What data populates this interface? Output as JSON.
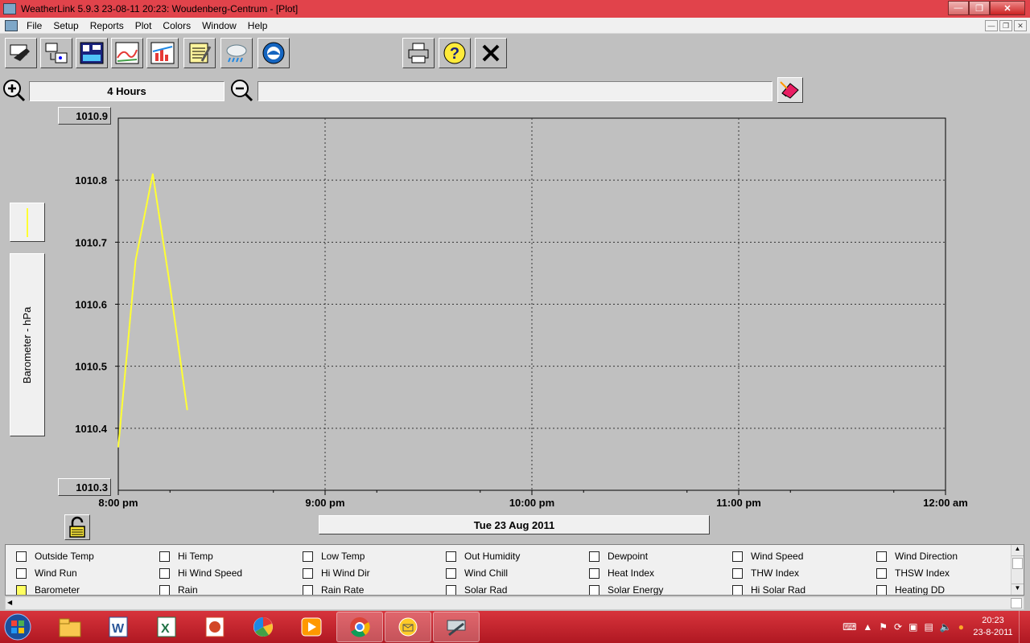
{
  "window": {
    "title": "WeatherLink 5.9.3  23-08-11  20:23: Woudenberg-Centrum - [Plot]"
  },
  "menu": [
    "File",
    "Setup",
    "Reports",
    "Plot",
    "Colors",
    "Window",
    "Help"
  ],
  "toolbar": {
    "icons": [
      "setup-icon",
      "download-icon",
      "bulletin-icon",
      "strip-chart-icon",
      "plot-icon",
      "notes-icon",
      "weather-icon",
      "noaa-icon",
      "print-icon",
      "help-icon",
      "close-icon"
    ]
  },
  "zoom": {
    "span_label": "4 Hours",
    "range_field": ""
  },
  "plot": {
    "y_axis_label": "Barometer - hPa",
    "y_top_label": "1010.9",
    "y_bottom_label": "1010.3",
    "date_label": "Tue 23 Aug 2011",
    "line_color": "#ffff33"
  },
  "chart_data": {
    "type": "line",
    "title": "",
    "ylabel": "Barometer - hPa",
    "xlabel": "Tue 23 Aug 2011",
    "ylim": [
      1010.3,
      1010.9
    ],
    "xlim": [
      "8:00 pm",
      "12:00 am"
    ],
    "yticks": [
      "1010.9",
      "1010.8",
      "1010.7",
      "1010.6",
      "1010.5",
      "1010.4",
      "1010.3"
    ],
    "xticks": [
      "8:00 pm",
      "9:00 pm",
      "10:00 pm",
      "11:00 pm",
      "12:00 am"
    ],
    "grid": true,
    "series": [
      {
        "x": [
          "20:00",
          "20:05",
          "20:10",
          "20:15",
          "20:20"
        ],
        "values": [
          1010.37,
          1010.67,
          1010.81,
          1010.63,
          1010.43
        ]
      }
    ]
  },
  "legend": [
    {
      "label": "Outside Temp",
      "checked": false
    },
    {
      "label": "Hi Temp",
      "checked": false
    },
    {
      "label": "Low Temp",
      "checked": false
    },
    {
      "label": "Out Humidity",
      "checked": false
    },
    {
      "label": "Dewpoint",
      "checked": false
    },
    {
      "label": "Wind Speed",
      "checked": false
    },
    {
      "label": "Wind Direction",
      "checked": false
    },
    {
      "label": "Wind Run",
      "checked": false
    },
    {
      "label": "Hi Wind Speed",
      "checked": false
    },
    {
      "label": "Hi Wind Dir",
      "checked": false
    },
    {
      "label": "Wind Chill",
      "checked": false
    },
    {
      "label": "Heat Index",
      "checked": false
    },
    {
      "label": "THW Index",
      "checked": false
    },
    {
      "label": "THSW Index",
      "checked": false
    },
    {
      "label": "Barometer",
      "checked": true
    },
    {
      "label": "Rain",
      "checked": false
    },
    {
      "label": "Rain Rate",
      "checked": false
    },
    {
      "label": "Solar Rad",
      "checked": false
    },
    {
      "label": "Solar Energy",
      "checked": false
    },
    {
      "label": "Hi Solar Rad",
      "checked": false
    },
    {
      "label": "Heating DD",
      "checked": false
    }
  ],
  "taskbar": {
    "apps": [
      "explorer-icon",
      "word-icon",
      "excel-icon",
      "powerpoint-icon",
      "picasa-icon",
      "media-player-icon",
      "chrome-icon",
      "outlook-icon",
      "weatherlink-icon"
    ],
    "time": "20:23",
    "date": "23-8-2011"
  }
}
